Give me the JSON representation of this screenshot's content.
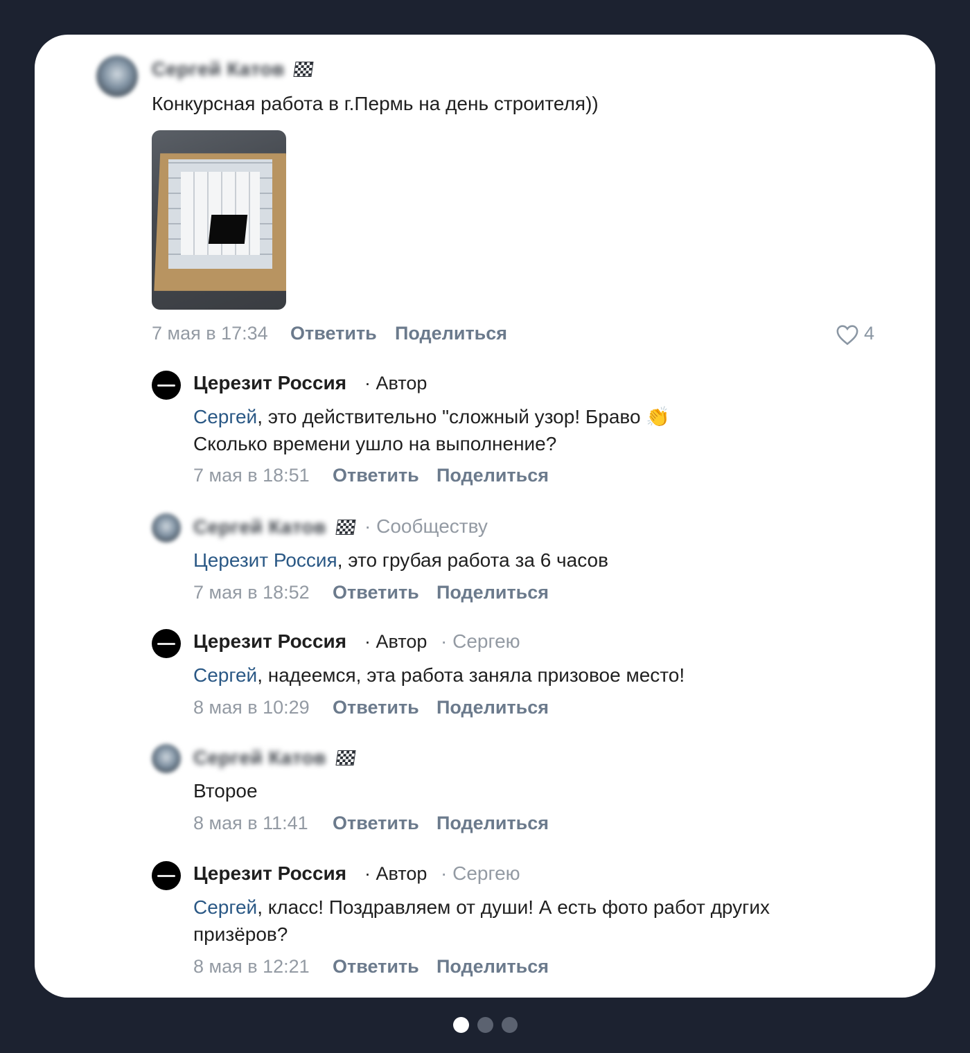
{
  "post": {
    "author_name": "Сергей Катов",
    "text": "Конкурсная работа в г.Пермь на день строителя))",
    "date": "7 мая в 17:34",
    "reply_label": "Ответить",
    "share_label": "Поделиться",
    "likes": "4"
  },
  "comments": [
    {
      "author": "Церезит Россия",
      "role": "· Автор",
      "mention": "Сергей",
      "text_line1": ", это действительно \"сложный узор! Браво 👏",
      "text_line2": "Сколько времени ушло на выполнение?",
      "date": "7 мая в 18:51",
      "reply_label": "Ответить",
      "share_label": "Поделиться"
    },
    {
      "author": "Сергей Катов",
      "to": "· Сообществу",
      "mention": "Церезит Россия",
      "text_line1": ", это грубая работа за 6 часов",
      "date": "7 мая в 18:52",
      "reply_label": "Ответить",
      "share_label": "Поделиться"
    },
    {
      "author": "Церезит Россия",
      "role": "· Автор",
      "to": "· Сергею",
      "mention": "Сергей",
      "text_line1": ", надеемся, эта работа заняла призовое место!",
      "date": "8 мая в 10:29",
      "reply_label": "Ответить",
      "share_label": "Поделиться"
    },
    {
      "author": "Сергей Катов",
      "text_line1": "Второе",
      "date": "8 мая в 11:41",
      "reply_label": "Ответить",
      "share_label": "Поделиться"
    },
    {
      "author": "Церезит Россия",
      "role": "· Автор",
      "to": "· Сергею",
      "mention": "Сергей",
      "text_line1": ", класс! Поздравляем от души! А есть фото работ других",
      "text_line2": "призёров?",
      "date": "8 мая в 12:21",
      "reply_label": "Ответить",
      "share_label": "Поделиться"
    }
  ],
  "pagination": {
    "total": 3,
    "active": 1
  },
  "colors": {
    "background": "#1c2230",
    "card": "#ffffff",
    "link": "#2a5885",
    "meta": "#939aa3"
  }
}
